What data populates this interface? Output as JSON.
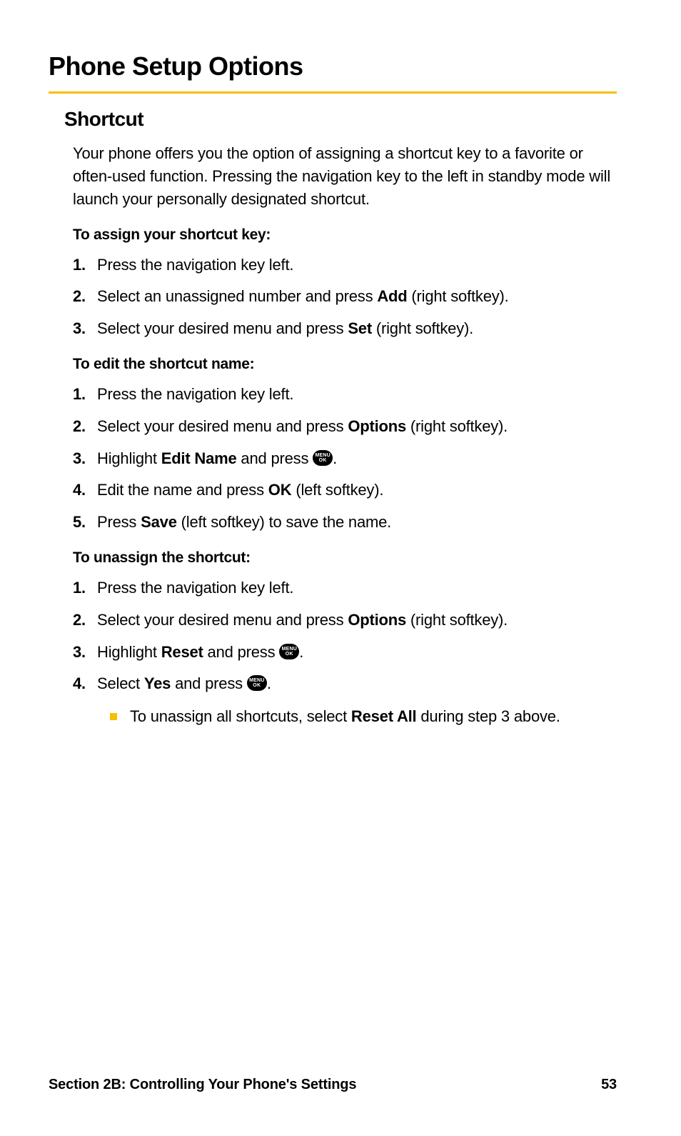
{
  "title": "Phone Setup Options",
  "subtitle": "Shortcut",
  "intro": "Your phone offers you the option of assigning a shortcut key to a favorite or often-used function. Pressing the navigation key to the left in standby mode will launch your personally designated shortcut.",
  "section1": {
    "heading": "To assign your shortcut key:",
    "steps": [
      {
        "num": "1.",
        "parts": [
          {
            "t": "Press the navigation key left."
          }
        ]
      },
      {
        "num": "2.",
        "parts": [
          {
            "t": "Select an unassigned number and press "
          },
          {
            "t": "Add",
            "b": true
          },
          {
            "t": " (right softkey)."
          }
        ]
      },
      {
        "num": "3.",
        "parts": [
          {
            "t": "Select your desired menu and press "
          },
          {
            "t": "Set",
            "b": true
          },
          {
            "t": " (right softkey)."
          }
        ]
      }
    ]
  },
  "section2": {
    "heading": "To edit the shortcut name:",
    "steps": [
      {
        "num": "1.",
        "parts": [
          {
            "t": "Press the navigation key left."
          }
        ]
      },
      {
        "num": "2.",
        "parts": [
          {
            "t": "Select your desired menu and press "
          },
          {
            "t": "Options",
            "b": true
          },
          {
            "t": " (right softkey)."
          }
        ]
      },
      {
        "num": "3.",
        "parts": [
          {
            "t": "Highlight "
          },
          {
            "t": "Edit Name",
            "b": true
          },
          {
            "t": " and press "
          },
          {
            "icon": "menu-ok"
          },
          {
            "t": "."
          }
        ]
      },
      {
        "num": "4.",
        "parts": [
          {
            "t": "Edit the name and press "
          },
          {
            "t": "OK",
            "b": true
          },
          {
            "t": " (left softkey)."
          }
        ]
      },
      {
        "num": "5.",
        "parts": [
          {
            "t": "Press "
          },
          {
            "t": "Save",
            "b": true
          },
          {
            "t": " (left softkey) to save the name."
          }
        ]
      }
    ]
  },
  "section3": {
    "heading": "To unassign the shortcut:",
    "steps": [
      {
        "num": "1.",
        "parts": [
          {
            "t": "Press the navigation key left."
          }
        ]
      },
      {
        "num": "2.",
        "parts": [
          {
            "t": "Select your desired menu and press "
          },
          {
            "t": "Options",
            "b": true
          },
          {
            "t": " (right softkey)."
          }
        ]
      },
      {
        "num": "3.",
        "parts": [
          {
            "t": "Highlight "
          },
          {
            "t": "Reset",
            "b": true
          },
          {
            "t": " and press "
          },
          {
            "icon": "menu-ok"
          },
          {
            "t": "."
          }
        ]
      },
      {
        "num": "4.",
        "parts": [
          {
            "t": "Select "
          },
          {
            "t": "Yes",
            "b": true
          },
          {
            "t": " and press "
          },
          {
            "icon": "menu-ok"
          },
          {
            "t": "."
          }
        ]
      }
    ],
    "sub_bullet_parts": [
      {
        "t": "To unassign all shortcuts, select "
      },
      {
        "t": "Reset All",
        "b": true
      },
      {
        "t": " during step 3 above."
      }
    ]
  },
  "footer": {
    "section": "Section 2B: Controlling Your Phone's Settings",
    "page": "53"
  },
  "icon_label": {
    "l1": "MENU",
    "l2": "OK"
  }
}
